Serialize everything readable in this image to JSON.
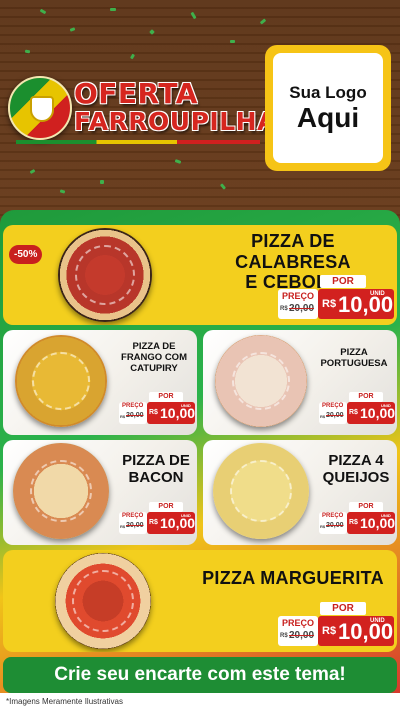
{
  "header": {
    "title_line1": "OFERTA",
    "title_line2": "FARROUPILHA",
    "logo_line1": "Sua Logo",
    "logo_line2": "Aqui",
    "emblem_icon": "rio-grande-do-sul-coat-of-arms-icon"
  },
  "colors": {
    "green": "#1f9a3b",
    "yellow": "#f3cf1e",
    "red": "#d2211f",
    "wood": "#5c3417"
  },
  "products": [
    {
      "name_l1": "PIZZA DE CALABRESA",
      "name_l2": "E CEBOLA",
      "badge": "-50%",
      "price_label": "PREÇO",
      "old_currency": "R$",
      "old_price": "20,00",
      "por_label": "POR",
      "currency": "R$",
      "price": "10,00",
      "unit": "UNID"
    },
    {
      "name_l1": "PIZZA DE",
      "name_l2": "FRANGO COM",
      "name_l3": "CATUPIRY",
      "price_label": "PREÇO",
      "old_currency": "R$",
      "old_price": "20,00",
      "por_label": "POR",
      "currency": "R$",
      "price": "10,00",
      "unit": "UNID"
    },
    {
      "name_l1": "PIZZA",
      "name_l2": "PORTUGUESA",
      "price_label": "PREÇO",
      "old_currency": "R$",
      "old_price": "20,00",
      "por_label": "POR",
      "currency": "R$",
      "price": "10,00",
      "unit": "UNID"
    },
    {
      "name_l1": "PIZZA DE",
      "name_l2": "BACON",
      "price_label": "PREÇO",
      "old_currency": "R$",
      "old_price": "20,00",
      "por_label": "POR",
      "currency": "R$",
      "price": "10,00",
      "unit": "UNID"
    },
    {
      "name_l1": "PIZZA 4",
      "name_l2": "QUEIJOS",
      "price_label": "PREÇO",
      "old_currency": "R$",
      "old_price": "20,00",
      "por_label": "POR",
      "currency": "R$",
      "price": "10,00",
      "unit": "UNID"
    },
    {
      "name_l1": "PIZZA MARGUERITA",
      "price_label": "PREÇO",
      "old_currency": "R$",
      "old_price": "20,00",
      "por_label": "POR",
      "currency": "R$",
      "price": "10,00",
      "unit": "UNID"
    }
  ],
  "cta": "Crie seu encarte com este tema!",
  "footer": "*Imagens Meramente Ilustrativas"
}
